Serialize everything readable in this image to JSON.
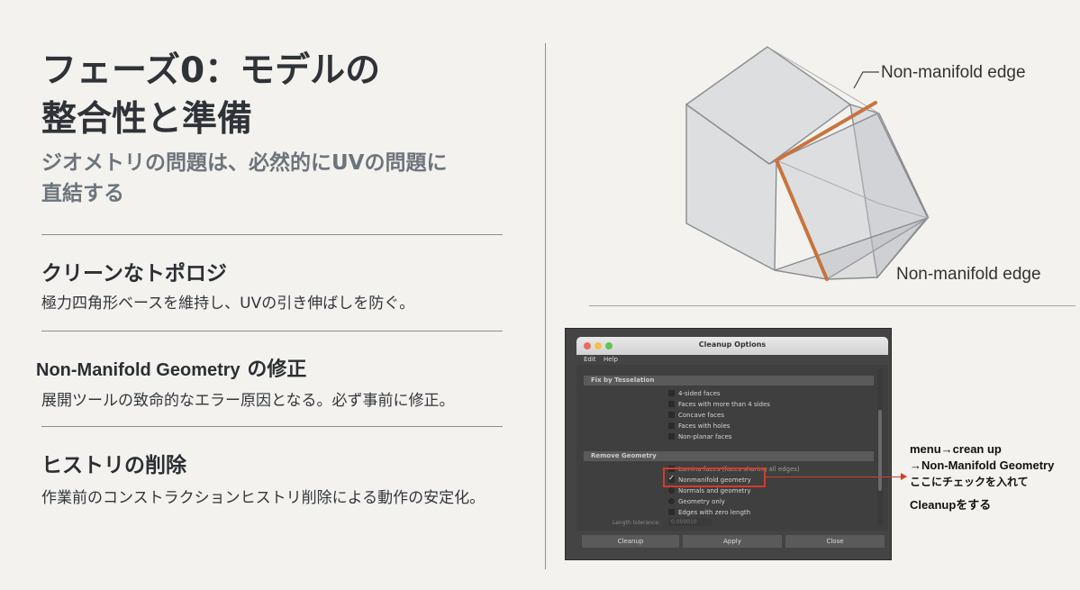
{
  "slide": {
    "title_line1": "フェーズ0：モデルの",
    "title_line2": "整合性と準備",
    "subtitle_line1": "ジオメトリの問題は、必然的にUVの問題に",
    "subtitle_line2": "直結する",
    "sections": [
      {
        "heading": "クリーンなトポロジ",
        "body": "極力四角形ベースを維持し、UVの引き伸ばしを防ぐ。"
      },
      {
        "heading_latin": "Non-Manifold Geometry",
        "heading_jp": " の修正",
        "body": "展開ツールの致命的なエラー原因となる。必ず事前に修正。"
      },
      {
        "heading": "ヒストリの削除",
        "body": "作業前のコンストラクションヒストリ削除による動作の安定化。"
      }
    ]
  },
  "diagram": {
    "label_top": "Non-manifold edge",
    "label_bottom": "Non-manifold edge",
    "edge_color": "#c8743e"
  },
  "window": {
    "title": "Cleanup Options",
    "menu": [
      "Edit",
      "Help"
    ],
    "fix_section": "Fix by Tesselation",
    "fix_options": [
      "4-sided faces",
      "Faces with more than 4 sides",
      "Concave faces",
      "Faces with holes",
      "Non-planar faces"
    ],
    "remove_section": "Remove Geometry",
    "remove_options": [
      "Lamina faces (faces sharing all edges)",
      "Nonmanifold geometry",
      "Normals and geometry",
      "Geometry only",
      "Edges with zero length"
    ],
    "length_label": "Length tolerance:",
    "length_value": "0.000010",
    "buttons": [
      "Cleanup",
      "Apply",
      "Close"
    ]
  },
  "annotation": {
    "line1": "menu→crean up",
    "line2": "→Non-Manifold Geometry",
    "line3": "ここにチェックを入れて",
    "line4": "Cleanupをする",
    "color": "#d43b2b"
  }
}
